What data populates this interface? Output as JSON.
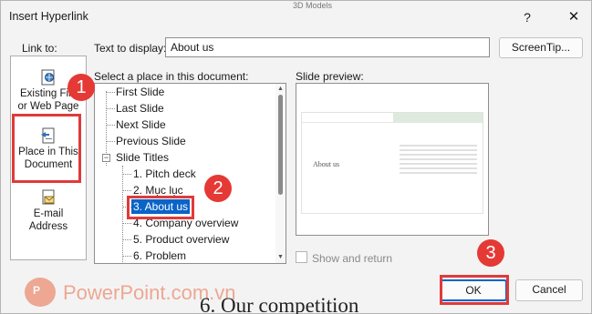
{
  "dialog": {
    "title": "Insert Hyperlink",
    "help_glyph": "?",
    "close_glyph": "✕"
  },
  "background": {
    "top_strip_text": "3D Models",
    "bottom_text": "6.  Our competition"
  },
  "labels": {
    "link_to": "Link to:",
    "text_to_display": "Text to display:",
    "select_place": "Select a place in this document:",
    "slide_preview": "Slide preview:"
  },
  "text_to_display_value": "About us",
  "buttons": {
    "screentip": "ScreenTip...",
    "ok": "OK",
    "cancel": "Cancel"
  },
  "link_to_items": [
    {
      "label_line1": "Existing File",
      "label_line2": "or Web Page",
      "icon": "globe-file-icon"
    },
    {
      "label_line1": "Place in This",
      "label_line2": "Document",
      "icon": "document-place-icon"
    },
    {
      "label_line1": "E-mail",
      "label_line2": "Address",
      "icon": "email-icon"
    }
  ],
  "tree": {
    "items": [
      {
        "label": "First Slide",
        "level": 0
      },
      {
        "label": "Last Slide",
        "level": 0
      },
      {
        "label": "Next Slide",
        "level": 0
      },
      {
        "label": "Previous Slide",
        "level": 0
      },
      {
        "label": "Slide Titles",
        "level": 0,
        "expanded": true
      },
      {
        "label": "1. Pitch deck",
        "level": 1
      },
      {
        "label": "2. Mục lục",
        "level": 1
      },
      {
        "label": "3. About us",
        "level": 1,
        "selected": true
      },
      {
        "label": "4. Company overview",
        "level": 1
      },
      {
        "label": "5. Product overview",
        "level": 1
      },
      {
        "label": "6. Problem",
        "level": 1
      }
    ]
  },
  "preview": {
    "slide_title": "About us"
  },
  "show_and_return": {
    "label": "Show and return",
    "checked": false,
    "enabled": false
  },
  "callouts": [
    "1",
    "2",
    "3"
  ],
  "watermark": {
    "text": "PowerPoint.com.vn",
    "logo_letter": "P"
  },
  "colors": {
    "callout_red": "#e53935",
    "selection_blue": "#0a64c8",
    "watermark_orange": "#e96a45"
  }
}
